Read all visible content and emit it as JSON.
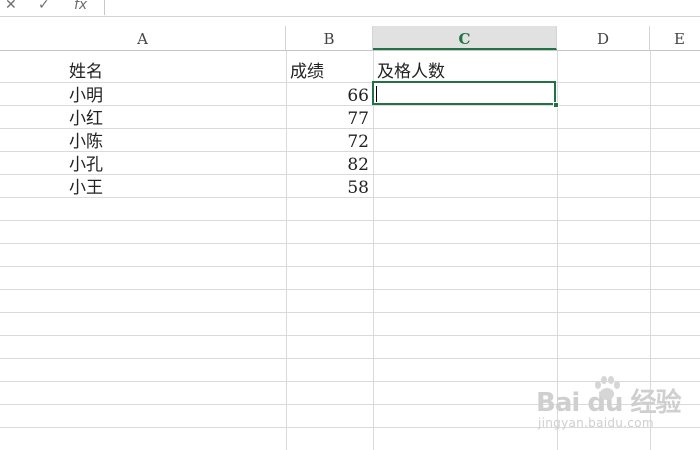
{
  "toolbar": {
    "cancel_icon": "close-icon",
    "enter_icon": "check-icon",
    "fx_label": "fx",
    "formula_value": ""
  },
  "columns": [
    "A",
    "B",
    "C",
    "D",
    "E"
  ],
  "active_column": "C",
  "rows": [
    {
      "a": "姓名",
      "b": "成绩",
      "c": "及格人数"
    },
    {
      "a": "小明",
      "b": "66",
      "c": ""
    },
    {
      "a": "小红",
      "b": "77",
      "c": ""
    },
    {
      "a": "小陈",
      "b": "72",
      "c": ""
    },
    {
      "a": "小孔",
      "b": "82",
      "c": ""
    },
    {
      "a": "小王",
      "b": "58",
      "c": ""
    }
  ],
  "watermark": {
    "brand": "Bai du 经验",
    "site": "jingyan.baidu.com"
  },
  "colors": {
    "accent": "#217346",
    "gridline": "#dadada",
    "header_active_bg": "#e1e1e1"
  }
}
